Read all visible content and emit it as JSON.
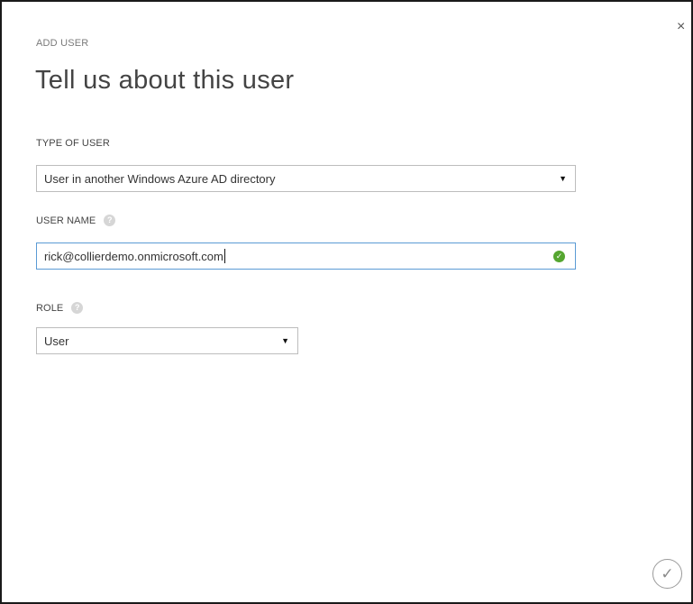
{
  "dialog": {
    "eyebrow": "ADD USER",
    "title": "Tell us about this user",
    "close_icon": "×",
    "confirm_icon": "✓"
  },
  "form": {
    "type_of_user": {
      "label": "TYPE OF USER",
      "value": "User in another Windows Azure AD directory"
    },
    "user_name": {
      "label": "USER NAME",
      "help_icon": "?",
      "value": "rick@collierdemo.onmicrosoft.com",
      "valid_icon": "✓"
    },
    "role": {
      "label": "ROLE",
      "help_icon": "?",
      "value": "User"
    }
  },
  "icons": {
    "dropdown_arrow": "▼"
  },
  "colors": {
    "valid": "#55a630",
    "focus_border": "#5b9bd5",
    "help": "#d6d6d6"
  }
}
